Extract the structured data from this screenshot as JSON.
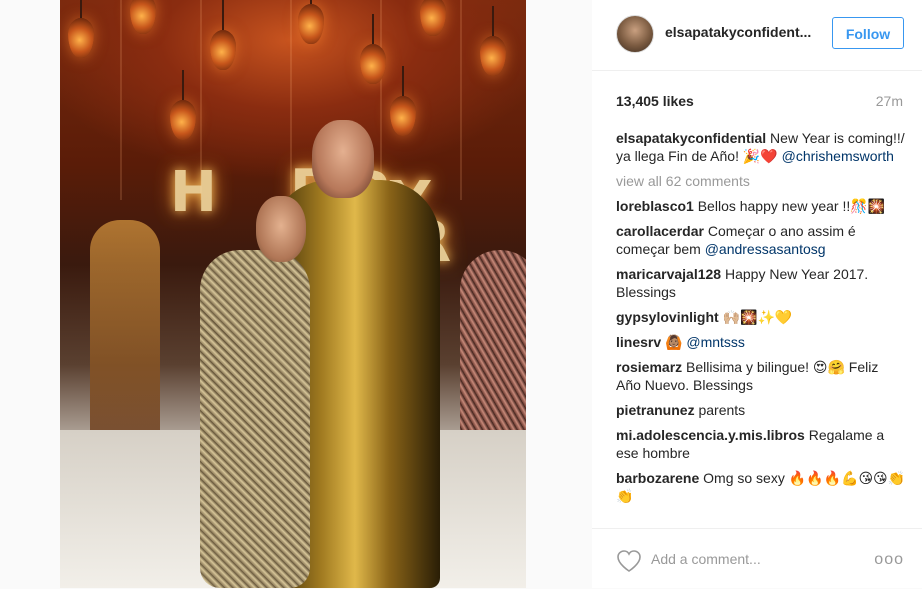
{
  "post": {
    "username": "elsapatakyconfident...",
    "follow_label": "Follow",
    "likes": "13,405 likes",
    "time": "27m",
    "caption": {
      "user": "elsapatakyconfidential",
      "text": " New Year is coming!!/ ya llega Fin de Año! 🎉❤️ ",
      "mention": "@chrishemsworth"
    },
    "view_all": "view all 62 comments",
    "comments": [
      {
        "user": "loreblasco1",
        "text": " Bellos happy new year !!🎊🎇",
        "mention": ""
      },
      {
        "user": "carollacerdar",
        "text": " Começar o ano assim é começar bem ",
        "mention": "@andressasantosg"
      },
      {
        "user": "maricarvajal128",
        "text": " Happy New Year 2017. Blessings",
        "mention": ""
      },
      {
        "user": "gypsylovinlight",
        "text": " 🙌🏼🎇✨💛",
        "mention": ""
      },
      {
        "user": "linesrv",
        "text": " 🙆🏽 ",
        "mention": "@mntsss"
      },
      {
        "user": "rosiemarz",
        "text": " Bellisima y bilingue! 😍🤗 Feliz Año Nuevo. Blessings",
        "mention": ""
      },
      {
        "user": "pietranunez",
        "text": " parents",
        "mention": ""
      },
      {
        "user": "mi.adolescencia.y.mis.libros",
        "text": " Regalame a ese hombre",
        "mention": ""
      },
      {
        "user": "barbozarene",
        "text": " Omg so sexy 🔥🔥🔥💪😘😘👏👏",
        "mention": ""
      }
    ],
    "add_comment_placeholder": "Add a comment...",
    "more_label": "ooo"
  },
  "photo": {
    "sign_letters": [
      "H",
      "P",
      "P",
      "Y",
      "R"
    ]
  },
  "colors": {
    "accent": "#3897f0",
    "mention": "#003569",
    "muted": "#999999"
  },
  "icons": [
    "heart-icon",
    "more-options-icon"
  ]
}
